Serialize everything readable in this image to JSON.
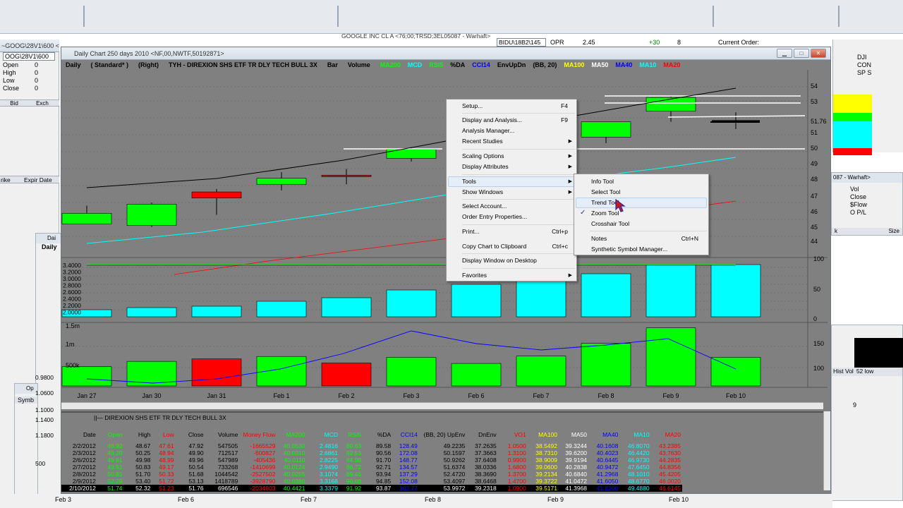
{
  "background_windows": {
    "top_title_1": "~GOOG\\28V1\\600 <76;00;TRSD;3EL05087 - Warhaft>",
    "top_title_2": "GOOGLE INC CL A <76;00;TRSD;3EL05087 - Warhaft>",
    "top_title_3": "BIDU\\18B2\\145",
    "top_opr": "OPR",
    "top_val1": "2.45",
    "top_val2": "+30",
    "top_val3": "8",
    "current_order": "Current Order:",
    "left_symbol": "OOG\\28V1\\600",
    "left_fields": [
      {
        "label": "Open",
        "value": "0"
      },
      {
        "label": "High",
        "value": "0"
      },
      {
        "label": "Low",
        "value": "0"
      },
      {
        "label": "Close",
        "value": "0"
      }
    ],
    "left_cols": [
      "Bid",
      "Exch"
    ],
    "left_cols2": [
      "rike",
      "Expir Date"
    ],
    "right_labels": [
      "DJI",
      "CON",
      "SP S"
    ],
    "right_title": "087 - Warhaft>",
    "right_fields": [
      "Vol",
      "Close",
      "$Flow",
      "O P/L"
    ],
    "right_cols": [
      "k",
      "Size"
    ],
    "right_cols2": [
      "Hist Vol",
      "52 low"
    ],
    "right_value": "9",
    "left_lower_labels": [
      "Dai",
      "Daily",
      "Op",
      "Symb"
    ],
    "left_lower_values": [
      "0.9800",
      "1.0600",
      "1.1000",
      "1.1400",
      "1.1800",
      "500"
    ],
    "bottom_axis": [
      "Feb 3",
      "Feb 6",
      "Feb 7",
      "Feb 8",
      "Feb 9",
      "Feb 10"
    ]
  },
  "chart_window": {
    "title": "Daily Chart 250 days 2010 <NF,00,NWTF,50192871>",
    "header": {
      "daily": "Daily",
      "standard": "( Standard* )",
      "right": "(Right)",
      "symbol_desc": "TYH - DIREXION SHS ETF TR DLY TECH BULL 3X",
      "bar": "Bar",
      "volume": "Volume",
      "indicators": [
        {
          "label": "MA200",
          "color": "#00ff00"
        },
        {
          "label": "MCD",
          "color": "#00ffff"
        },
        {
          "label": "RSI5",
          "color": "#00ff00"
        },
        {
          "label": "%DA",
          "color": "#000000"
        },
        {
          "label": "CCI14",
          "color": "#0000ff"
        },
        {
          "label": "EnvUpDn",
          "color": "#000000"
        },
        {
          "label": "(BB, 20)",
          "color": "#000000"
        },
        {
          "label": "MA100",
          "color": "#ffff00"
        },
        {
          "label": "MA50",
          "color": "#ffffff"
        },
        {
          "label": "MA40",
          "color": "#0000ff"
        },
        {
          "label": "MA10",
          "color": "#00ffff"
        },
        {
          "label": "MA20",
          "color": "#ff0000"
        }
      ]
    },
    "price_axis": [
      "54",
      "53",
      "51.76",
      "52",
      "51",
      "50",
      "49",
      "48",
      "47",
      "46",
      "45",
      "44"
    ],
    "mid_axis_left": [
      "3.4000",
      "3.2000",
      "3.0000",
      "2.8000",
      "2.6000",
      "2.4000",
      "2.2000",
      "2.0000"
    ],
    "mid_axis_right": [
      "100",
      "50",
      "0"
    ],
    "vol_axis_left": [
      "1.5m",
      "1m",
      "500k"
    ],
    "vol_axis_right": [
      "150",
      "100"
    ],
    "date_axis": [
      "Jan 27",
      "Jan 30",
      "Jan 31",
      "Feb 1",
      "Feb 2",
      "Feb 3",
      "Feb 6",
      "Feb 7",
      "Feb 8",
      "Feb 9",
      "Feb 10"
    ]
  },
  "context_menu": {
    "items": [
      {
        "label": "Setup...",
        "key": "F4"
      },
      {
        "label": "Display and Analysis...",
        "key": "F9"
      },
      {
        "label": "Analysis Manager...",
        "key": ""
      },
      {
        "label": "Recent Studies",
        "key": ""
      },
      {
        "label": "Scaling Options",
        "key": ""
      },
      {
        "label": "Display Attributes",
        "key": ""
      },
      {
        "label": "Tools",
        "key": ""
      },
      {
        "label": "Show Windows",
        "key": ""
      },
      {
        "label": "Select Account...",
        "key": ""
      },
      {
        "label": "Order Entry Properties...",
        "key": ""
      },
      {
        "label": "Print...",
        "key": "Ctrl+p"
      },
      {
        "label": "Copy Chart to Clipboard",
        "key": "Ctrl+c"
      },
      {
        "label": "Display Window on Desktop",
        "key": ""
      },
      {
        "label": "Favorites",
        "key": ""
      }
    ]
  },
  "tools_submenu": {
    "items": [
      {
        "label": "Info Tool",
        "key": ""
      },
      {
        "label": "Select Tool",
        "key": ""
      },
      {
        "label": "Trend Tool",
        "key": ""
      },
      {
        "label": "Zoom Tool",
        "key": ""
      },
      {
        "label": "Crosshair Tool",
        "key": ""
      },
      {
        "label": "Notes",
        "key": "Ctrl+N"
      },
      {
        "label": "Synthetic Symbol Manager...",
        "key": ""
      }
    ]
  },
  "data_table": {
    "title": "DIREXION SHS ETF TR DLY TECH BULL 3X",
    "headers": [
      "Date",
      "Open",
      "High",
      "Low",
      "Close",
      "Volume",
      "Money Flow",
      "MA200",
      "MCD",
      "RSI5",
      "%DA",
      "CCI14",
      "(BB, 20) UpEnv",
      "DnEnv",
      "VO1",
      "MA100",
      "MA50",
      "MA40",
      "MA10",
      "MA20"
    ],
    "header_colors": [
      "#000",
      "#00ff00",
      "#000",
      "#ff0000",
      "#000",
      "#000",
      "#ff0000",
      "#00ff00",
      "#00ffff",
      "#00ff00",
      "#000",
      "#0000ff",
      "#000",
      "#000",
      "#ff0000",
      "#ffff00",
      "#ffffff",
      "#0000ff",
      "#00ffff",
      "#ff0000"
    ],
    "rows": [
      [
        "2/2/2012",
        "48.92",
        "48.67",
        "47.61",
        "47.92",
        "547505",
        "-1665529",
        "40.0530",
        "2.4816",
        "80.63",
        "89.58",
        "128.49",
        "49.2235",
        "37.2635",
        "1.0500",
        "38.5492",
        "39.3244",
        "40.1608",
        "46.8070",
        "43.2385"
      ],
      [
        "2/3/2012",
        "49.20",
        "50.25",
        "48.94",
        "49.90",
        "712517",
        "-600827",
        "40.0310",
        "2.6861",
        "82.53",
        "90.56",
        "172.08",
        "50.1597",
        "37.3663",
        "1.3100",
        "38.7310",
        "39.6200",
        "40.4023",
        "46.4420",
        "43.7630"
      ],
      [
        "2/6/2012",
        "49.91",
        "49.98",
        "48.99",
        "49.96",
        "547989",
        "-405436",
        "40.0110",
        "2.8225",
        "84.98",
        "91.70",
        "148.77",
        "50.9262",
        "37.6408",
        "0.9900",
        "38.9009",
        "39.9194",
        "40.6445",
        "46.9730",
        "44.2835"
      ],
      [
        "2/7/2012",
        "49.51",
        "50.83",
        "49.17",
        "50.54",
        "733268",
        "-1410699",
        "40.0124",
        "2.9490",
        "86.72",
        "92.71",
        "134.57",
        "51.6374",
        "38.0336",
        "1.6800",
        "39.0600",
        "40.2838",
        "40.9472",
        "47.6450",
        "44.8356"
      ],
      [
        "2/8/2012",
        "50.81",
        "51.70",
        "50.33",
        "51.68",
        "1044542",
        "-2527502",
        "40.0255",
        "3.1074",
        "89.46",
        "93.94",
        "137.29",
        "52.4720",
        "38.3690",
        "1.3700",
        "39.2134",
        "40.6840",
        "41.2968",
        "48.1010",
        "45.4205"
      ],
      [
        "2/9/2012",
        "52.29",
        "53.40",
        "51.72",
        "53.13",
        "1418789",
        "-3928790",
        "40.0380",
        "3.3168",
        "90.68",
        "94.85",
        "152.08",
        "53.4097",
        "38.6468",
        "1.4700",
        "39.3722",
        "41.0472",
        "41.6050",
        "48.6770",
        "46.0020"
      ],
      [
        "2/10/2012",
        "51.74",
        "52.32",
        "51.23",
        "51.76",
        "696546",
        "-2034803",
        "40.4421",
        "3.3379",
        "91.92",
        "93.87",
        "163.77",
        "53.9972",
        "39.2318",
        "1.0900",
        "39.5171",
        "41.3968",
        "41.8200",
        "49.4880",
        "46.6145"
      ]
    ],
    "cell_colors": [
      "#000",
      "#00ff00",
      "#000",
      "#ff0000",
      "#000",
      "#000",
      "#ff0000",
      "#00ff00",
      "#00ffff",
      "#00ff00",
      "#000",
      "#0000ff",
      "#000",
      "#000",
      "#ff0000",
      "#ffff00",
      "#ffffff",
      "#0000ff",
      "#00ffff",
      "#ff0000"
    ]
  }
}
